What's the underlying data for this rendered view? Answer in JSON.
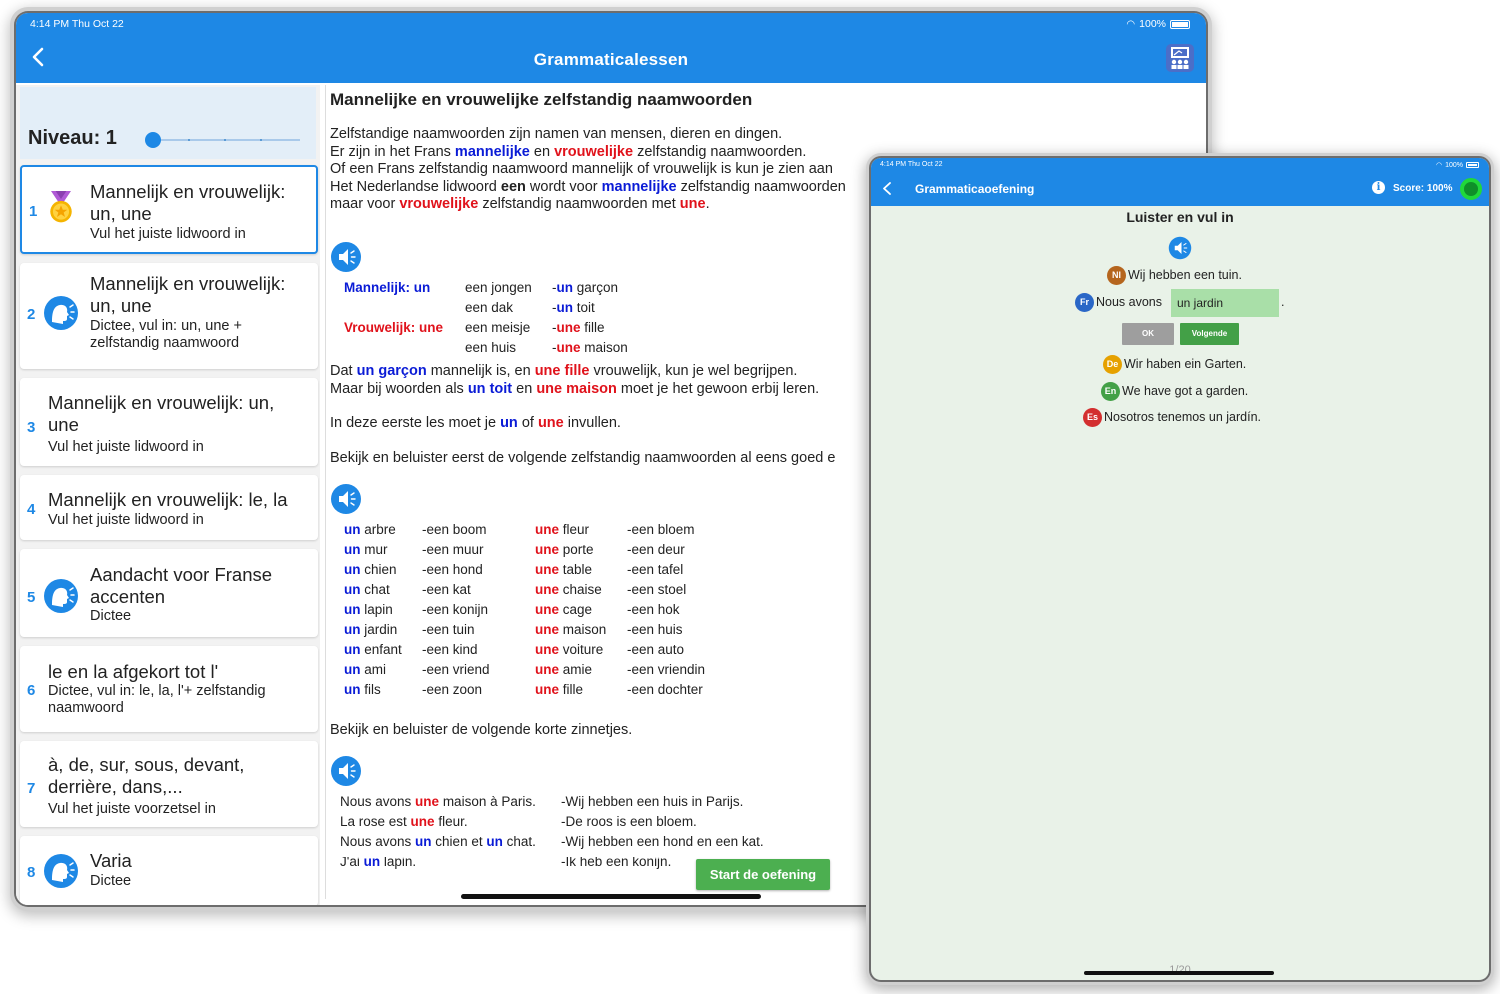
{
  "main": {
    "status": {
      "time_date": "4:14 PM   Thu Oct 22",
      "battery": "100%"
    },
    "title": "Grammaticalessen",
    "level_label": "Niveau: 1",
    "lessons": [
      {
        "num": "1",
        "title": "Mannelijk en vrouwelijk: un, une",
        "sub": "Vul het juiste lidwoord in",
        "icon": "medal-icon"
      },
      {
        "num": "2",
        "title": "Mannelijk en vrouwelijk: un, une",
        "sub": "Dictee, vul in: un, une + zelfstandig naamwoord",
        "icon": "speaking-head-icon"
      },
      {
        "num": "3",
        "title": "Mannelijk en vrouwelijk: un, une",
        "sub": "Vul het juiste lidwoord in",
        "icon": ""
      },
      {
        "num": "4",
        "title": "Mannelijk en vrouwelijk: le, la",
        "sub": "Vul het juiste lidwoord in",
        "icon": ""
      },
      {
        "num": "5",
        "title": "Aandacht voor Franse accenten",
        "sub": "Dictee",
        "icon": "speaking-head-icon"
      },
      {
        "num": "6",
        "title": "le en la afgekort tot l'",
        "sub": "Dictee, vul in: le, la, l'+ zelfstandig naamwoord",
        "icon": ""
      },
      {
        "num": "7",
        "title": "à, de, sur, sous, devant, derrière, dans,...",
        "sub": "Vul het juiste voorzetsel in",
        "icon": ""
      },
      {
        "num": "8",
        "title": "Varia",
        "sub": "Dictee",
        "icon": "speaking-head-icon"
      }
    ],
    "content": {
      "heading": "Mannelijke en vrouwelijke zelfstandig naamwoorden",
      "intro": {
        "l1": "Zelfstandige naamwoorden zijn namen van mensen, dieren en dingen.",
        "l2a": "Er zijn in het Frans ",
        "l2b": "mannelijke",
        "l2c": " en ",
        "l2d": "vrouwelijke",
        "l2e": " zelfstandig naamwoorden.",
        "l3": "Of een Frans zelfstandig naamwoord mannelijk of vrouwelijk is kun je zien aan",
        "l4a": "Het Nederlandse lidwoord ",
        "l4b": "een",
        "l4c": " wordt voor ",
        "l4d": "mannelijke",
        "l4e": " zelfstandig naamwoorden",
        "l5a": "maar voor ",
        "l5b": "vrouwelijke",
        "l5c": " zelfstandig naamwoorden met ",
        "l5d": "une",
        "l5e": "."
      },
      "example": {
        "m_label": "Mannelijk: un",
        "f_label": "Vrouwelijk: une",
        "nl": [
          "een jongen",
          "een dak",
          "een meisje",
          "een huis"
        ],
        "fr_art": [
          "un",
          "un",
          "une",
          "une"
        ],
        "fr_word": [
          " garçon",
          " toit",
          " fille",
          " maison"
        ]
      },
      "p2": {
        "a": "Dat ",
        "b": "un garçon",
        "c": " mannelijk is, en ",
        "d": "une fille",
        "e": " vrouwelijk, kun je wel begrijpen.",
        "f": "Maar bij woorden als ",
        "g": "un toit",
        "h": " en ",
        "i": "une maison",
        "j": " moet je het gewoon erbij leren."
      },
      "p3": {
        "a": "In deze eerste les moet je ",
        "b": "un",
        "c": " of ",
        "d": "une",
        "e": " invullen."
      },
      "p4": "Bekijk en beluister eerst de volgende zelfstandig naamwoorden al eens goed e",
      "vocab_m": [
        {
          "art": "un",
          "fr": " arbre",
          "nl": "-een boom"
        },
        {
          "art": "un",
          "fr": " mur",
          "nl": "-een muur"
        },
        {
          "art": "un",
          "fr": " chien",
          "nl": "-een hond"
        },
        {
          "art": "un",
          "fr": " chat",
          "nl": "-een kat"
        },
        {
          "art": "un",
          "fr": " lapin",
          "nl": "-een konijn"
        },
        {
          "art": "un",
          "fr": " jardin",
          "nl": "-een tuin"
        },
        {
          "art": "un",
          "fr": " enfant",
          "nl": "-een kind"
        },
        {
          "art": "un",
          "fr": " ami",
          "nl": "-een vriend"
        },
        {
          "art": "un",
          "fr": " fils",
          "nl": "-een zoon"
        }
      ],
      "vocab_f": [
        {
          "art": "une",
          "fr": " fleur",
          "nl": "-een bloem"
        },
        {
          "art": "une",
          "fr": " porte",
          "nl": "-een deur"
        },
        {
          "art": "une",
          "fr": " table",
          "nl": "-een tafel"
        },
        {
          "art": "une",
          "fr": " chaise",
          "nl": "-een stoel"
        },
        {
          "art": "une",
          "fr": " cage",
          "nl": "-een hok"
        },
        {
          "art": "une",
          "fr": " maison",
          "nl": "-een huis"
        },
        {
          "art": "une",
          "fr": " voiture",
          "nl": "-een auto"
        },
        {
          "art": "une",
          "fr": " amie",
          "nl": "-een vriendin"
        },
        {
          "art": "une",
          "fr": " fille",
          "nl": "-een dochter"
        }
      ],
      "p5": "Bekijk en beluister de volgende korte zinnetjes.",
      "sentences": [
        {
          "a": "Nous avons ",
          "b": "une",
          "c": " maison à Paris.",
          "bcolor": "red",
          "nl": "-Wij hebben een huis in Parijs."
        },
        {
          "a": "La rose est ",
          "b": "une",
          "c": " fleur.",
          "bcolor": "red",
          "nl": "-De roos is een bloem."
        },
        {
          "a": "Nous avons ",
          "b": "un",
          "c": " chien et ",
          "d": "un",
          "e": " chat.",
          "bcolor": "blue",
          "nl": "-Wij hebben een hond en een kat."
        },
        {
          "a": "J'ai ",
          "b": "un",
          "c": " lapin.",
          "bcolor": "blue",
          "nl": "-Ik heb een konijn."
        }
      ],
      "start_button": "Start de oefening"
    }
  },
  "exercise": {
    "status": {
      "time_date": "4:14 PM   Thu Oct 22",
      "battery": "100%"
    },
    "title": "Grammaticaoefening",
    "score": "Score: 100%",
    "heading": "Luister en vul in",
    "nl_flag": "Nl",
    "nl_sentence": "Wij hebben een tuin.",
    "fr_flag": "Fr",
    "fr_prefix": "Nous avons",
    "fr_input": "un jardin",
    "fr_suffix": ".",
    "ok_button": "OK",
    "next_button": "Volgende",
    "de_flag": "De",
    "de_sentence": "Wir haben ein Garten.",
    "en_flag": "En",
    "en_sentence": "We have got a garden.",
    "es_flag": "Es",
    "es_sentence": "Nosotros tenemos un jardín.",
    "page_indicator": "1/20",
    "colors": {
      "bar": "#1e88e5",
      "background": "#e9f2e8",
      "input": "#a9dfa8",
      "next": "#43a047"
    }
  }
}
